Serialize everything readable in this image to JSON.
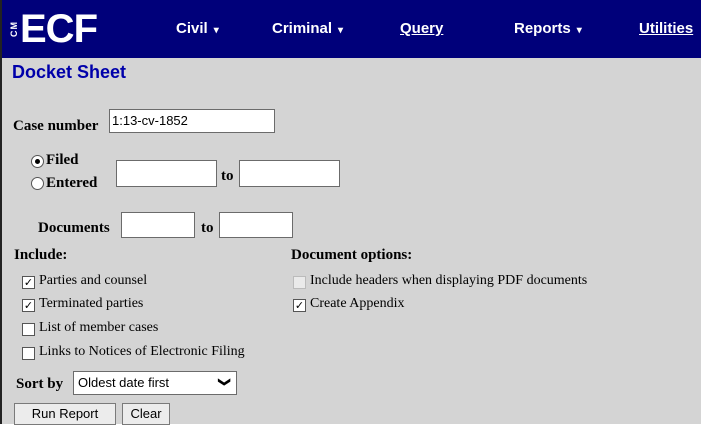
{
  "app": {
    "logo_small": "CM",
    "logo_main": "ECF"
  },
  "nav": {
    "civil": "Civil",
    "criminal": "Criminal",
    "query": "Query",
    "reports": "Reports",
    "utilities": "Utilities",
    "caret": "▾"
  },
  "page_title": "Docket Sheet",
  "case_number": {
    "label": "Case number",
    "value": "1:13-cv-1852"
  },
  "date_type": {
    "filed": "Filed",
    "entered": "Entered",
    "selected": "Filed",
    "to": "to",
    "from_value": "",
    "to_value": ""
  },
  "documents": {
    "label": "Documents",
    "to": "to",
    "from_value": "",
    "to_value": ""
  },
  "include": {
    "heading": "Include:",
    "items": [
      {
        "label": "Parties and counsel",
        "checked": true
      },
      {
        "label": "Terminated parties",
        "checked": true
      },
      {
        "label": "List of member cases",
        "checked": false
      },
      {
        "label": "Links to Notices of Electronic Filing",
        "checked": false
      }
    ]
  },
  "document_options": {
    "heading": "Document options:",
    "items": [
      {
        "label": "Include headers when displaying PDF documents",
        "checked": false,
        "disabled": true
      },
      {
        "label": "Create Appendix",
        "checked": true,
        "disabled": false
      }
    ]
  },
  "sort": {
    "label": "Sort by",
    "value": "Oldest date first",
    "chevron": "❯"
  },
  "buttons": {
    "run": "Run Report",
    "clear": "Clear"
  },
  "check_glyph": "✓",
  "colors": {
    "topbar": "#00007a",
    "title": "#0000aa",
    "background": "#d4d4d4"
  }
}
